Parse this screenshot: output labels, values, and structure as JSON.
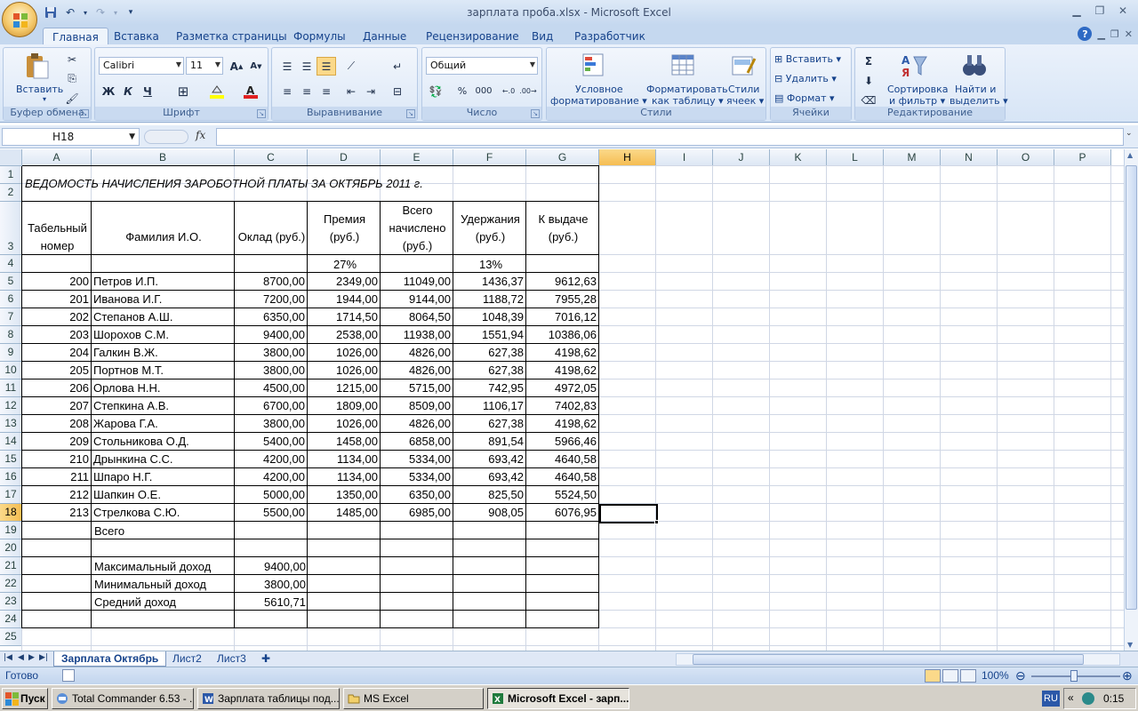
{
  "window": {
    "title": "зарплата проба.xlsx - Microsoft Excel",
    "quick_access": [
      "save-icon",
      "undo-icon",
      "redo-icon",
      "customize-icon"
    ]
  },
  "ribbon": {
    "tabs": [
      "Главная",
      "Вставка",
      "Разметка страницы",
      "Формулы",
      "Данные",
      "Рецензирование",
      "Вид",
      "Разработчик"
    ],
    "active_tab": "Главная",
    "clipboard": {
      "paste": "Вставить",
      "label": "Буфер обмена"
    },
    "font": {
      "name": "Calibri",
      "size": "11",
      "bold": "Ж",
      "italic": "К",
      "underline": "Ч",
      "label": "Шрифт"
    },
    "alignment": {
      "label": "Выравнивание"
    },
    "number": {
      "format": "Общий",
      "label": "Число"
    },
    "styles": {
      "cond_format_1": "Условное",
      "cond_format_2": "форматирование",
      "format_table_1": "Форматировать",
      "format_table_2": "как таблицу",
      "cell_styles_1": "Стили",
      "cell_styles_2": "ячеек",
      "label": "Стили"
    },
    "cells": {
      "insert": "Вставить",
      "delete": "Удалить",
      "format": "Формат",
      "label": "Ячейки"
    },
    "editing": {
      "sort_1": "Сортировка",
      "sort_2": "и фильтр",
      "find_1": "Найти и",
      "find_2": "выделить",
      "label": "Редактирование"
    }
  },
  "formula_bar": {
    "name_box": "H18",
    "fx": "fx",
    "formula": ""
  },
  "sheet": {
    "columns": [
      "A",
      "B",
      "C",
      "D",
      "E",
      "F",
      "G",
      "H",
      "I",
      "J",
      "K",
      "L",
      "M",
      "N",
      "O",
      "P"
    ],
    "rows": [
      "1",
      "2",
      "3",
      "4",
      "5",
      "6",
      "7",
      "8",
      "9",
      "10",
      "11",
      "12",
      "13",
      "14",
      "15",
      "16",
      "17",
      "18",
      "19",
      "20",
      "21",
      "22",
      "23",
      "24",
      "25"
    ],
    "title": "ВЕДОМОСТЬ НАЧИСЛЕНИЯ ЗАРОБОТНОЙ ПЛАТЫ        ЗА ОКТЯБРЬ 2011 г.",
    "headers": [
      "Табельный номер",
      "Фамилия И.О.",
      "Оклад (руб.)",
      "Премия (руб.)",
      "Всего начислено (руб.)",
      "Удержания (руб.)",
      "К выдаче (руб.)"
    ],
    "rates": {
      "premium": "27%",
      "deduction": "13%"
    },
    "data_rows": [
      [
        "200",
        "Петров И.П.",
        "8700,00",
        "2349,00",
        "11049,00",
        "1436,37",
        "9612,63"
      ],
      [
        "201",
        "Иванова И.Г.",
        "7200,00",
        "1944,00",
        "9144,00",
        "1188,72",
        "7955,28"
      ],
      [
        "202",
        "Степанов А.Ш.",
        "6350,00",
        "1714,50",
        "8064,50",
        "1048,39",
        "7016,12"
      ],
      [
        "203",
        "Шорохов С.М.",
        "9400,00",
        "2538,00",
        "11938,00",
        "1551,94",
        "10386,06"
      ],
      [
        "204",
        "Галкин В.Ж.",
        "3800,00",
        "1026,00",
        "4826,00",
        "627,38",
        "4198,62"
      ],
      [
        "205",
        "Портнов М.Т.",
        "3800,00",
        "1026,00",
        "4826,00",
        "627,38",
        "4198,62"
      ],
      [
        "206",
        "Орлова Н.Н.",
        "4500,00",
        "1215,00",
        "5715,00",
        "742,95",
        "4972,05"
      ],
      [
        "207",
        "Степкина А.В.",
        "6700,00",
        "1809,00",
        "8509,00",
        "1106,17",
        "7402,83"
      ],
      [
        "208",
        "Жарова Г.А.",
        "3800,00",
        "1026,00",
        "4826,00",
        "627,38",
        "4198,62"
      ],
      [
        "209",
        "Стольникова О.Д.",
        "5400,00",
        "1458,00",
        "6858,00",
        "891,54",
        "5966,46"
      ],
      [
        "210",
        "Дрынкина С.С.",
        "4200,00",
        "1134,00",
        "5334,00",
        "693,42",
        "4640,58"
      ],
      [
        "211",
        "Шпаро Н.Г.",
        "4200,00",
        "1134,00",
        "5334,00",
        "693,42",
        "4640,58"
      ],
      [
        "212",
        "Шапкин О.Е.",
        "5000,00",
        "1350,00",
        "6350,00",
        "825,50",
        "5524,50"
      ],
      [
        "213",
        "Стрелкова С.Ю.",
        "5500,00",
        "1485,00",
        "6985,00",
        "908,05",
        "6076,95"
      ]
    ],
    "total_label": "Всего",
    "stats": [
      {
        "label": "Максимальный доход",
        "value": "9400,00"
      },
      {
        "label": "Минимальный доход",
        "value": "3800,00"
      },
      {
        "label": "Средний доход",
        "value": "5610,71"
      }
    ],
    "selected_cell": "H18"
  },
  "sheet_tabs": [
    "Зарплата Октябрь",
    "Лист2",
    "Лист3"
  ],
  "status": {
    "ready": "Готово",
    "zoom": "100%"
  },
  "taskbar": {
    "start": "Пуск",
    "items": [
      "Total Commander 6.53 - ...",
      "Зарплата таблицы под...",
      "MS Excel",
      "Microsoft Excel - зарп..."
    ],
    "lang": "RU",
    "time": "0:15"
  }
}
